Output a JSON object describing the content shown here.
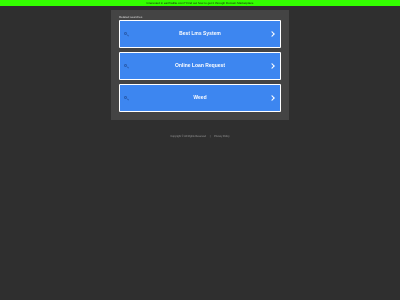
{
  "banner": {
    "text": "Interested in earthwillie.com? Find out how to get it through Domain Marketplace",
    "color": "#33ff00"
  },
  "panel": {
    "heading": "Related searches"
  },
  "results": [
    {
      "label": "Best Lms System",
      "icon": "search-icon"
    },
    {
      "label": "Online Loan Request",
      "icon": "search-icon"
    },
    {
      "label": "Weed",
      "icon": "search-icon"
    }
  ],
  "footer": {
    "copyright": "Copyright © All Rights Reserved",
    "separator": "|",
    "privacy": "Privacy Policy"
  },
  "colors": {
    "accent": "#3d86f0",
    "background": "#2f2f2f",
    "panel": "#444444"
  }
}
